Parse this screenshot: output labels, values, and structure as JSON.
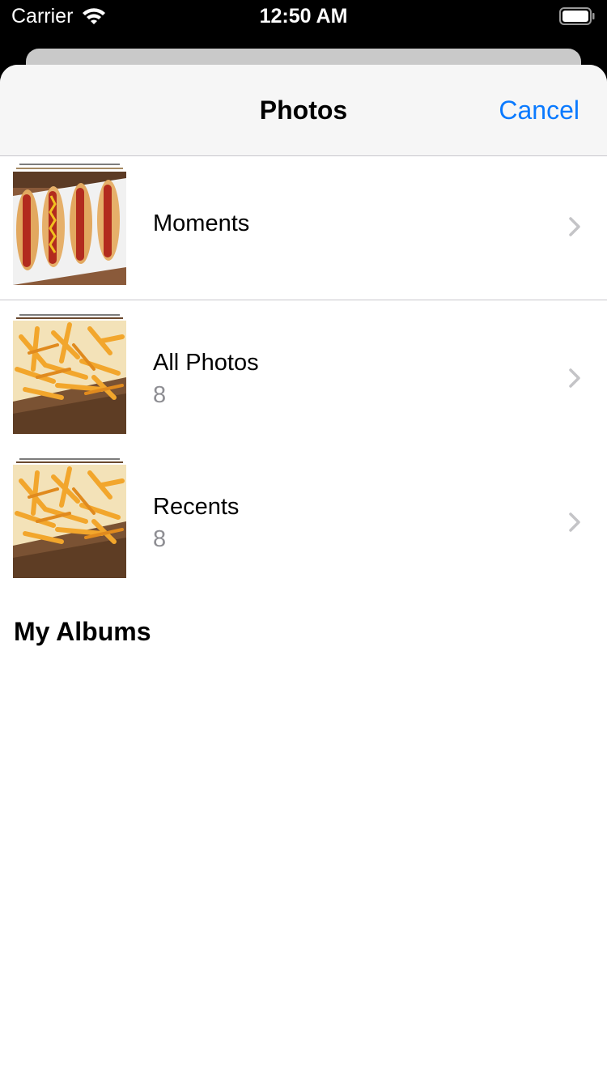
{
  "status_bar": {
    "carrier": "Carrier",
    "time": "12:50 AM"
  },
  "navbar": {
    "title": "Photos",
    "cancel_label": "Cancel"
  },
  "rows": [
    {
      "title": "Moments",
      "count": "",
      "thumbnail": "hotdogs-photo"
    },
    {
      "title": "All Photos",
      "count": "8",
      "thumbnail": "fries-photo"
    },
    {
      "title": "Recents",
      "count": "8",
      "thumbnail": "fries-photo"
    }
  ],
  "section": {
    "my_albums": "My Albums"
  },
  "colors": {
    "accent": "#0a7aff",
    "secondary_text": "#8e8e93",
    "separator": "#c8c7cc",
    "navbar_bg": "#f6f6f6"
  }
}
